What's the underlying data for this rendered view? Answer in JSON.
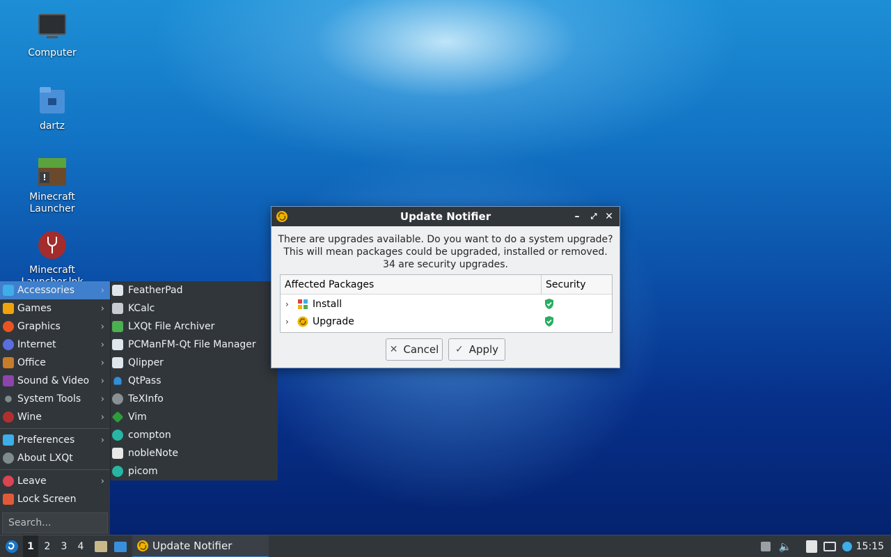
{
  "desktop": {
    "icons": [
      {
        "label": "Computer"
      },
      {
        "label": "dartz"
      },
      {
        "label": "Minecraft\nLauncher"
      },
      {
        "label": "Minecraft\nLauncher.lnk"
      }
    ]
  },
  "menu": {
    "categories": [
      {
        "label": "Accessories",
        "icon": "accessories-icon",
        "color": "#3daee9"
      },
      {
        "label": "Games",
        "icon": "games-icon",
        "color": "#f0a30a"
      },
      {
        "label": "Graphics",
        "icon": "graphics-icon",
        "color": "#e95420"
      },
      {
        "label": "Internet",
        "icon": "internet-icon",
        "color": "#5a6ee0"
      },
      {
        "label": "Office",
        "icon": "office-icon",
        "color": "#c77c2a"
      },
      {
        "label": "Sound & Video",
        "icon": "sound-video-icon",
        "color": "#8e44ad"
      },
      {
        "label": "System Tools",
        "icon": "system-tools-icon",
        "color": "#7f8c8d"
      },
      {
        "label": "Wine",
        "icon": "wine-icon",
        "color": "#b03030"
      }
    ],
    "extras": [
      {
        "label": "Preferences",
        "icon": "preferences-icon",
        "color": "#3daee9"
      },
      {
        "label": "About LXQt",
        "icon": "about-icon",
        "color": "#7f8c8d"
      }
    ],
    "session": [
      {
        "label": "Leave",
        "icon": "leave-icon",
        "color": "#da4453"
      },
      {
        "label": "Lock Screen",
        "icon": "lock-icon",
        "color": "#e05a3a"
      }
    ],
    "search_placeholder": "Search...",
    "accessories": [
      {
        "label": "FeatherPad",
        "icon": "featherpad-icon",
        "color": "#dfe6ec"
      },
      {
        "label": "KCalc",
        "icon": "kcalc-icon",
        "color": "#c9cdd1"
      },
      {
        "label": "LXQt File Archiver",
        "icon": "archiver-icon",
        "color": "#4caf50"
      },
      {
        "label": "PCManFM-Qt File Manager",
        "icon": "file-manager-icon",
        "color": "#dfe6ec"
      },
      {
        "label": "Qlipper",
        "icon": "qlipper-icon",
        "color": "#dfe6ec"
      },
      {
        "label": "QtPass",
        "icon": "qtpass-icon",
        "color": "#2f8fd8"
      },
      {
        "label": "TeXInfo",
        "icon": "texinfo-icon",
        "color": "#8a8f94"
      },
      {
        "label": "Vim",
        "icon": "vim-icon",
        "color": "#2e9c3c"
      },
      {
        "label": "compton",
        "icon": "compton-icon",
        "color": "#27b6a4"
      },
      {
        "label": "nobleNote",
        "icon": "noblenote-icon",
        "color": "#e8e8e8"
      },
      {
        "label": "picom",
        "icon": "picom-icon",
        "color": "#27b6a4"
      }
    ]
  },
  "dialog": {
    "title": "Update Notifier",
    "message_line1": "There are upgrades available. Do you want to do a system upgrade?",
    "message_line2": "This will mean packages could be upgraded, installed or removed.",
    "message_line3": "34 are security upgrades.",
    "columns": {
      "packages": "Affected Packages",
      "security": "Security"
    },
    "rows": [
      {
        "label": "Install",
        "icon": "install-icon"
      },
      {
        "label": "Upgrade",
        "icon": "upgrade-icon"
      }
    ],
    "cancel_label": "Cancel",
    "apply_label": "Apply",
    "colors": {
      "titlebar": "#31363b",
      "accent": "#f0b400",
      "shield": "#27ae60"
    }
  },
  "taskbar": {
    "workspaces": [
      "1",
      "2",
      "3",
      "4"
    ],
    "active_workspace": "1",
    "task_label": "Update Notifier",
    "clock": "15:15"
  }
}
